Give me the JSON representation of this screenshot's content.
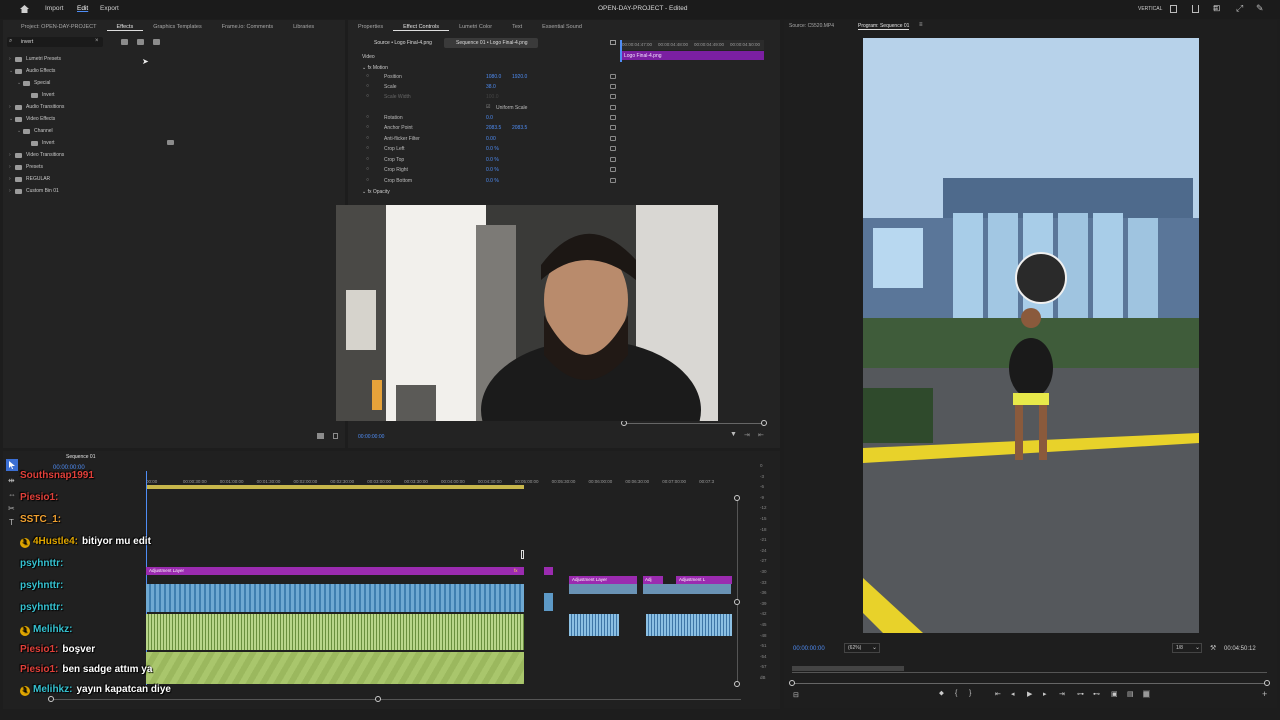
{
  "menu": {
    "import": "Import",
    "edit": "Edit",
    "export": "Export"
  },
  "title": "OPEN-DAY-PROJECT - Edited",
  "workspace": "VERTICAL",
  "left_tabs": [
    "Project: OPEN-DAY-PROJECT",
    "Effects",
    "Graphics Templates",
    "Frame.io: Comments",
    "Libraries"
  ],
  "search_value": "invert",
  "effects_tree": [
    {
      "label": "Lumetri Presets",
      "indent": 0,
      "chev": "›"
    },
    {
      "label": "Audio Effects",
      "indent": 0,
      "chev": "⌄"
    },
    {
      "label": "Special",
      "indent": 1,
      "chev": "⌄"
    },
    {
      "label": "Invert",
      "indent": 2,
      "chev": ""
    },
    {
      "label": "Audio Transitions",
      "indent": 0,
      "chev": "›"
    },
    {
      "label": "Video Effects",
      "indent": 0,
      "chev": "⌄"
    },
    {
      "label": "Channel",
      "indent": 1,
      "chev": "⌄"
    },
    {
      "label": "Invert",
      "indent": 2,
      "chev": ""
    },
    {
      "label": "Video Transitions",
      "indent": 0,
      "chev": "›"
    },
    {
      "label": "Presets",
      "indent": 0,
      "chev": "›"
    },
    {
      "label": "REGULAR",
      "indent": 0,
      "chev": "›"
    },
    {
      "label": "Custom Bin 01",
      "indent": 0,
      "chev": "›"
    }
  ],
  "mid_tabs": [
    "Properties",
    "Effect Controls",
    "Lumetri Color",
    "Text",
    "Essential Sound"
  ],
  "ec": {
    "source_label": "Source • Logo Final-4.png",
    "seq_label": "Sequence 01 • Logo Final-4.png",
    "clip_label": "Logo Final-4.png",
    "time_ticks": [
      "00:00:04:47:00",
      "00:00:04:48:00",
      "00:00:04:49:00",
      "00:00:04:50:00"
    ],
    "video": "Video",
    "motion": "Motion",
    "params": [
      {
        "name": "Position",
        "v1": "1080.0",
        "v2": "1920.0"
      },
      {
        "name": "Scale",
        "v1": "38.0",
        "v2": ""
      },
      {
        "name": "Scale Width",
        "v1": "100.0",
        "v2": ""
      },
      {
        "name": "Uniform Scale",
        "v1": "",
        "v2": ""
      },
      {
        "name": "Rotation",
        "v1": "0.0",
        "v2": ""
      },
      {
        "name": "Anchor Point",
        "v1": "2083.5",
        "v2": "2083.5"
      },
      {
        "name": "Anti-flicker Filter",
        "v1": "0.00",
        "v2": ""
      },
      {
        "name": "Crop Left",
        "v1": "0.0 %",
        "v2": ""
      },
      {
        "name": "Crop Top",
        "v1": "0.0 %",
        "v2": ""
      },
      {
        "name": "Crop Right",
        "v1": "0.0 %",
        "v2": ""
      },
      {
        "name": "Crop Bottom",
        "v1": "0.0 %",
        "v2": ""
      }
    ],
    "opacity": "Opacity",
    "timecode": "00:00:00:00"
  },
  "source_tab": "Source: C5520.MP4",
  "program_tab": "Program: Sequence 01",
  "program": {
    "timecode": "00:00:00:00",
    "zoom": "(62%)",
    "quality": "1/8",
    "duration": "00:04:50:12"
  },
  "timeline": {
    "seq_tab": "Sequence 01",
    "timecode": "00:00:00:00",
    "ruler": [
      "00:00",
      "00:00:30:00",
      "00:01:00:00",
      "00:01:30:00",
      "00:02:00:00",
      "00:02:30:00",
      "00:03:00:00",
      "00:03:30:00",
      "00:04:00:00",
      "00:04:30:00",
      "00:05:00:00",
      "00:05:30:00",
      "00:06:00:00",
      "00:06:30:00",
      "00:07:00:00",
      "00:07:3"
    ],
    "clips": {
      "adjustment": "Adjustment Layer",
      "adj_short": "Adj",
      "adj_l": "Adjustment L"
    },
    "meter": [
      "0",
      "-3",
      "-6",
      "-9",
      "-12",
      "-15",
      "-18",
      "-21",
      "-24",
      "-27",
      "-30",
      "-33",
      "-36",
      "-39",
      "-42",
      "-45",
      "-48",
      "-51",
      "-54",
      "-57",
      "dB"
    ]
  },
  "chat": [
    {
      "user": "Southsnap1991",
      "color": "#e0403a",
      "msg": ""
    },
    {
      "user": "Piesio1:",
      "color": "#e0403a",
      "msg": ""
    },
    {
      "user": "SSTC_1:",
      "color": "#f0a030",
      "msg": ""
    },
    {
      "user": "4Hustle4:",
      "color": "#e0a600",
      "msg": "bitiyor mu edit"
    },
    {
      "user": "psyhnttr:",
      "color": "#35c1d0",
      "msg": ""
    },
    {
      "user": "psyhnttr:",
      "color": "#35c1d0",
      "msg": ""
    },
    {
      "user": "psyhnttr:",
      "color": "#35c1d0",
      "msg": ""
    },
    {
      "user": "Melihkz:",
      "color": "#35c1d0",
      "msg": ""
    },
    {
      "user": "Piesio1:",
      "color": "#e0403a",
      "msg": "boşver"
    },
    {
      "user": "Piesio1:",
      "color": "#e0403a",
      "msg": "ben sadge attım ya"
    },
    {
      "user": "Melihkz:",
      "color": "#35c1d0",
      "msg": "yayın kapatcan diye"
    }
  ],
  "colors": {
    "accent": "#4f8df5",
    "purple": "#9b2bb0",
    "audio_green": "#b8d58a",
    "audio_blue": "#7fb4d8"
  }
}
